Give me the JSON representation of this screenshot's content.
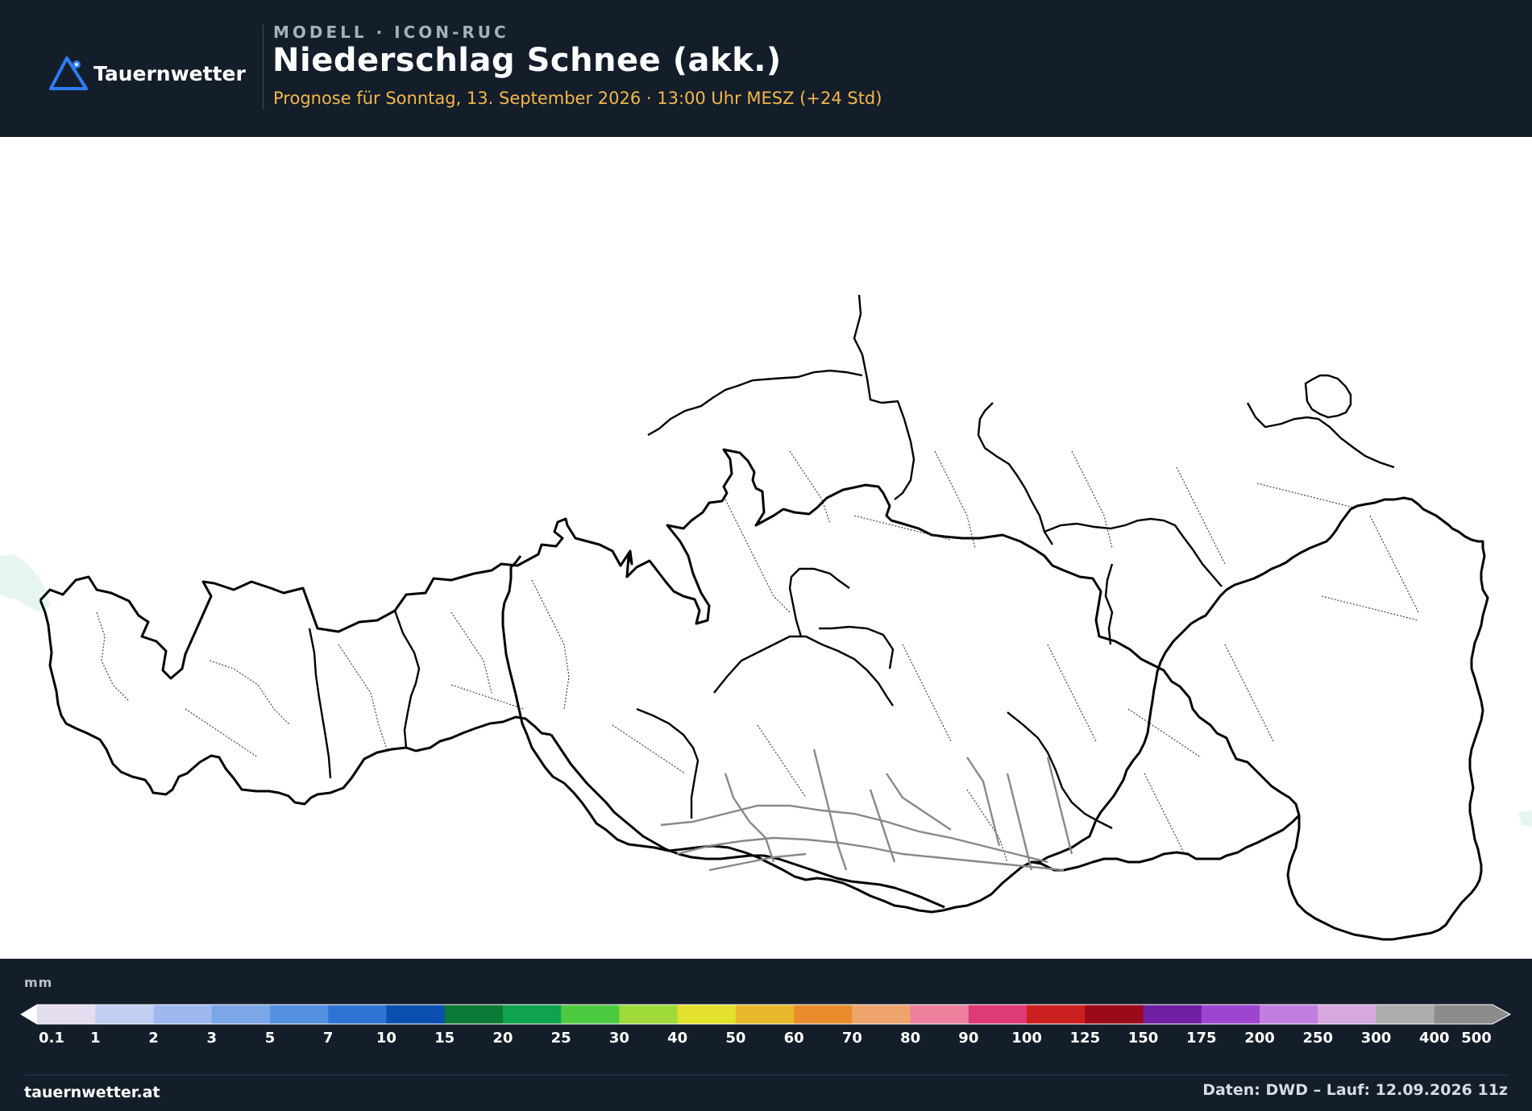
{
  "header": {
    "brand": "Tauernwetter",
    "model_label": "MODELL · ICON-RUC",
    "title": "Niederschlag Schnee (akk.)",
    "subtitle": "Prognose für Sonntag, 13. September 2026 · 13:00 Uhr MESZ  (+24 Std)"
  },
  "legend": {
    "unit": "mm",
    "ticks": [
      "0.1",
      "1",
      "2",
      "3",
      "5",
      "7",
      "10",
      "15",
      "20",
      "25",
      "30",
      "40",
      "50",
      "60",
      "70",
      "80",
      "90",
      "100",
      "125",
      "150",
      "175",
      "200",
      "250",
      "300",
      "400",
      "500"
    ],
    "colors": [
      "#e4ddf0",
      "#c2cff3",
      "#9fb8ee",
      "#7ba6e8",
      "#5590e0",
      "#2f74d2",
      "#0a4fb0",
      "#0c7a37",
      "#0fa24f",
      "#4ec942",
      "#9fd93a",
      "#e3e12b",
      "#e6b82a",
      "#ea8c2b",
      "#f0a46d",
      "#ee7f9d",
      "#de3a78",
      "#cc1f1f",
      "#9b0a1a",
      "#6f1fa3",
      "#9d45cf",
      "#c17ee0",
      "#d7a8e0",
      "#adadad",
      "#8c8c8c"
    ]
  },
  "footer": {
    "website": "tauernwetter.at",
    "data_source": "Daten: DWD – Lauf: 12.09.2026 11z"
  }
}
